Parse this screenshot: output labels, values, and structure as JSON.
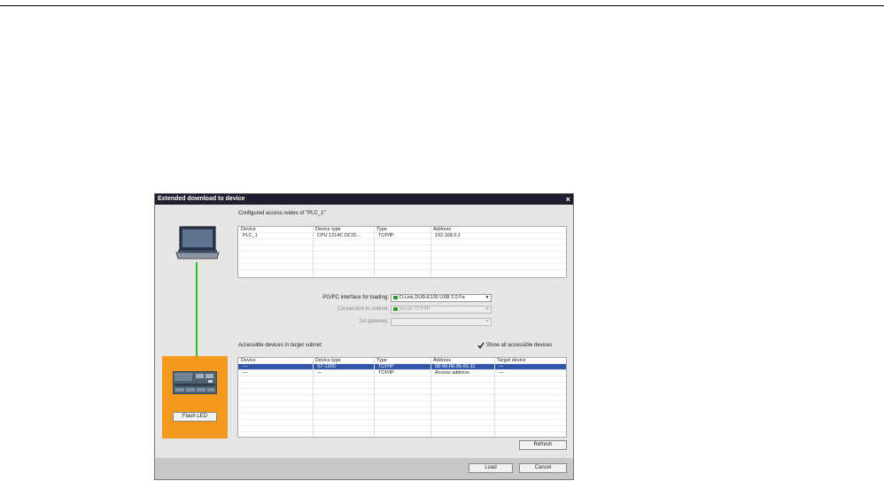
{
  "dialog": {
    "title": "Extended download to device",
    "close_label": "×"
  },
  "configured": {
    "heading": "Configured access nodes of \"PLC_1\"",
    "columns": [
      "Device",
      "Device type",
      "Type",
      "Address"
    ],
    "rows": [
      [
        "PLC_1",
        "CPU 1214C DC/D...",
        "TCP/IP",
        "192.168.0.1"
      ]
    ]
  },
  "interface": {
    "pgpc_label": "PG/PC interface for loading:",
    "pgpc_value": "D-Link DUB-E100 USB 2.0 Fa",
    "subnet_label": "Connection to subnet:",
    "subnet_value": "(local) TCP/IP",
    "gateway_label": "1st gateway:",
    "gateway_value": ""
  },
  "accessible": {
    "heading": "Accessible devices in target subnet:",
    "show_all_label": "Show all accessible devices",
    "show_all_checked": true,
    "columns": [
      "Device",
      "Device type",
      "Type",
      "Address",
      "Target device"
    ],
    "rows": [
      [
        "—",
        "S7-1200",
        "TCP/IP",
        "08-00-06-95-91-11",
        "—"
      ],
      [
        "—",
        "—",
        "TCP/IP",
        "Access address",
        "—"
      ]
    ]
  },
  "left_panel": {
    "flash_led_label": "Flash LED",
    "pc_icon": "laptop-icon",
    "plc_icon": "plc-device-icon",
    "link_color": "#22c022",
    "highlight_color": "#f39a1c"
  },
  "buttons": {
    "refresh": "Refresh",
    "load": "Load",
    "cancel": "Cancel"
  }
}
